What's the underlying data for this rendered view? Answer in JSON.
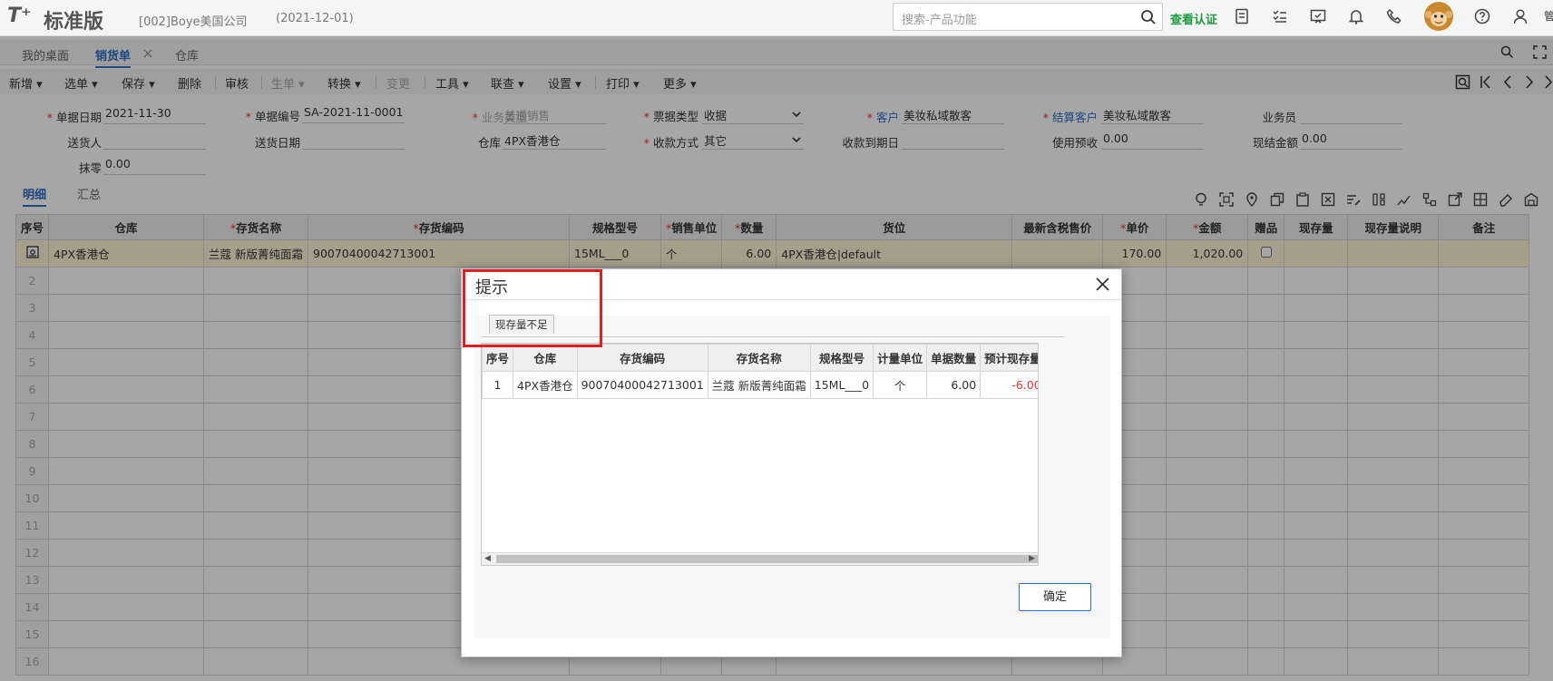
{
  "header": {
    "logo_mark": "T⁺",
    "logo_text": "标准版",
    "company": "[002]Boye美国公司",
    "period": "(2021-12-01)",
    "search_placeholder": "搜索-产品功能",
    "verify_link": "查看认证",
    "user_label": "管"
  },
  "tabs": [
    {
      "label": "我的桌面"
    },
    {
      "label": "销货单"
    },
    {
      "label": "仓库"
    }
  ],
  "toolbar": {
    "items": [
      "新增",
      "选单",
      "保存",
      "删除",
      "审核",
      "生单",
      "转换",
      "变更",
      "工具",
      "联查",
      "设置",
      "打印",
      "更多"
    ]
  },
  "form": {
    "doc_date_label": "单据日期",
    "doc_date": "2021-11-30",
    "doc_no_label": "单据编号",
    "doc_no": "SA-2021-11-0001",
    "biz_type_label": "业务类型",
    "biz_type": "普通销售",
    "invoice_type_label": "票据类型",
    "invoice_type": "收据",
    "customer_label": "客户",
    "customer": "美妆私域散客",
    "settle_customer_label": "结算客户",
    "settle_customer": "美妆私域散客",
    "salesman_label": "业务员",
    "salesman": "",
    "deliverer_label": "送货人",
    "deliverer": "",
    "delivery_date_label": "送货日期",
    "delivery_date": "",
    "warehouse_label": "仓库",
    "warehouse": "4PX香港仓",
    "pay_method_label": "收款方式",
    "pay_method": "其它",
    "due_date_label": "收款到期日",
    "due_date": "",
    "prepay_label": "使用预收",
    "prepay": "0.00",
    "cash_label": "现结金额",
    "cash": "0.00",
    "rounding_label": "抹零",
    "rounding": "0.00"
  },
  "subtabs": [
    "明细",
    "汇总"
  ],
  "grid": {
    "headers": [
      "序号",
      "仓库",
      "存货名称",
      "存货编码",
      "规格型号",
      "销售单位",
      "数量",
      "货位",
      "最新含税售价",
      "单价",
      "金额",
      "赠品",
      "现存量",
      "现存量说明",
      "备注"
    ],
    "rows": [
      {
        "warehouse": "4PX香港仓",
        "name": "兰蔻 新版菁纯面霜",
        "code": "90070400042713001",
        "spec": "15ML___0",
        "unit": "个",
        "qty": "6.00",
        "location": "4PX香港仓|default",
        "latest_price": "",
        "price": "170.00",
        "amount": "1,020.00"
      }
    ],
    "row_numbers": [
      "2",
      "3",
      "4",
      "5",
      "6",
      "7",
      "8",
      "9",
      "10",
      "11",
      "12",
      "13",
      "14",
      "15",
      "16"
    ]
  },
  "dialog": {
    "title": "提示",
    "tab": "现存量不足",
    "headers": [
      "序号",
      "仓库",
      "存货编码",
      "存货名称",
      "规格型号",
      "计量单位",
      "单据数量",
      "预计现存量"
    ],
    "rows": [
      {
        "no": "1",
        "warehouse": "4PX香港仓",
        "code": "90070400042713001",
        "name": "兰蔻 新版菁纯面霜",
        "spec": "15ML___0",
        "unit": "个",
        "qty": "6.00",
        "expected": "-6.00"
      }
    ],
    "ok_label": "确定"
  },
  "colors": {
    "accent": "#2d6fc4",
    "required": "#e33333",
    "verify": "#1a9b3c",
    "highlight": "#e02020"
  }
}
